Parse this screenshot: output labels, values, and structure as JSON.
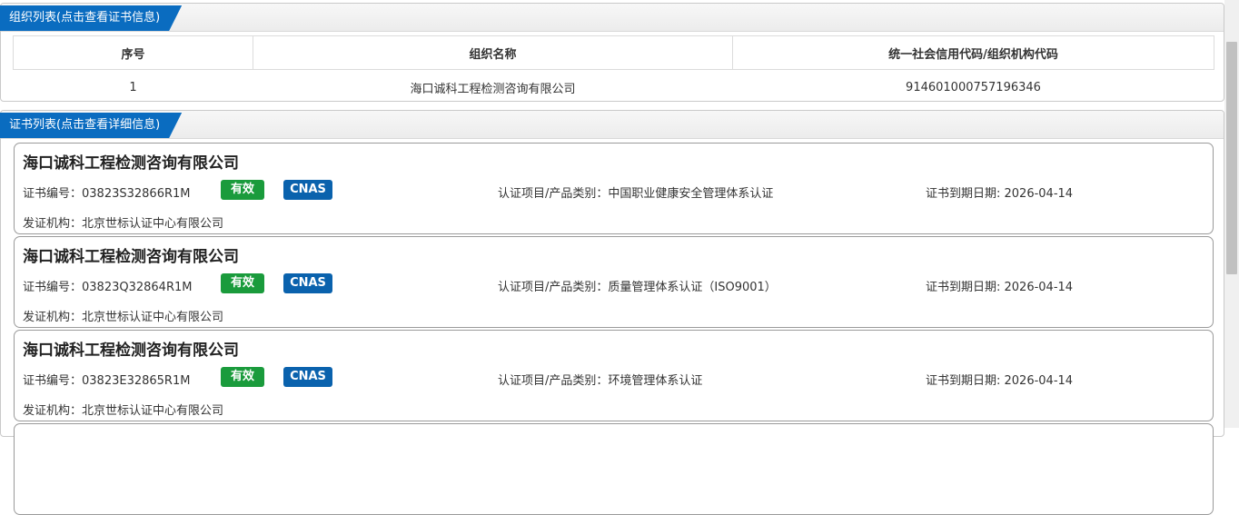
{
  "org_panel": {
    "title": "组织列表(点击查看证书信息)",
    "columns": [
      "序号",
      "组织名称",
      "统一社会信用代码/组织机构代码"
    ],
    "rows": [
      {
        "index": "1",
        "name": "海口诚科工程检测咨询有限公司",
        "code": "914601000757196346"
      }
    ]
  },
  "cert_panel": {
    "title": "证书列表(点击查看详细信息)",
    "certs": [
      {
        "company": "海口诚科工程检测咨询有限公司",
        "cert_no": "证书编号：03823S32866R1M",
        "status": "有效",
        "accreditation": "CNAS",
        "item": "认证项目/产品类别：中国职业健康安全管理体系认证",
        "expire": "证书到期日期: 2026-04-14",
        "issuer": "发证机构：北京世标认证中心有限公司"
      },
      {
        "company": "海口诚科工程检测咨询有限公司",
        "cert_no": "证书编号：03823Q32864R1M",
        "status": "有效",
        "accreditation": "CNAS",
        "item": "认证项目/产品类别：质量管理体系认证（ISO9001）",
        "expire": "证书到期日期: 2026-04-14",
        "issuer": "发证机构：北京世标认证中心有限公司"
      },
      {
        "company": "海口诚科工程检测咨询有限公司",
        "cert_no": "证书编号：03823E32865R1M",
        "status": "有效",
        "accreditation": "CNAS",
        "item": "认证项目/产品类别：环境管理体系认证",
        "expire": "证书到期日期: 2026-04-14",
        "issuer": "发证机构：北京世标认证中心有限公司"
      }
    ]
  },
  "colors": {
    "tab_blue": "#0a6cc0",
    "valid_green": "#1a9b3c",
    "cnas_blue": "#0a62ad"
  }
}
